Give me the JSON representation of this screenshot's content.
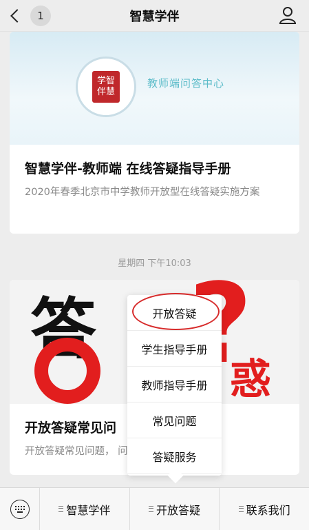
{
  "topbar": {
    "badge": "1",
    "title": "智慧学伴"
  },
  "card1": {
    "seal_text": "学智伴慧",
    "cover_text": "教师端问答中心",
    "headline": "智慧学伴-教师端 在线答疑指导手册",
    "desc": "2020年春季北京市中学教师开放型在线答疑实施方案"
  },
  "timestamp": "星期四 下午10:03",
  "card2": {
    "cover_big": "答",
    "cover_q": "?",
    "cover_red": "惑",
    "headline": "开放答疑常见问",
    "desc": "开放答疑常见问题，                    问题。"
  },
  "popup": {
    "items": [
      "开放答疑",
      "学生指导手册",
      "教师指导手册",
      "常见问题",
      "答疑服务"
    ]
  },
  "bottombar": {
    "menus": [
      "智慧学伴",
      "开放答疑",
      "联系我们"
    ]
  },
  "colors": {
    "highlight": "#d72b2b",
    "accent_cyan": "#5cbcc9",
    "seal_red": "#c0282b"
  }
}
